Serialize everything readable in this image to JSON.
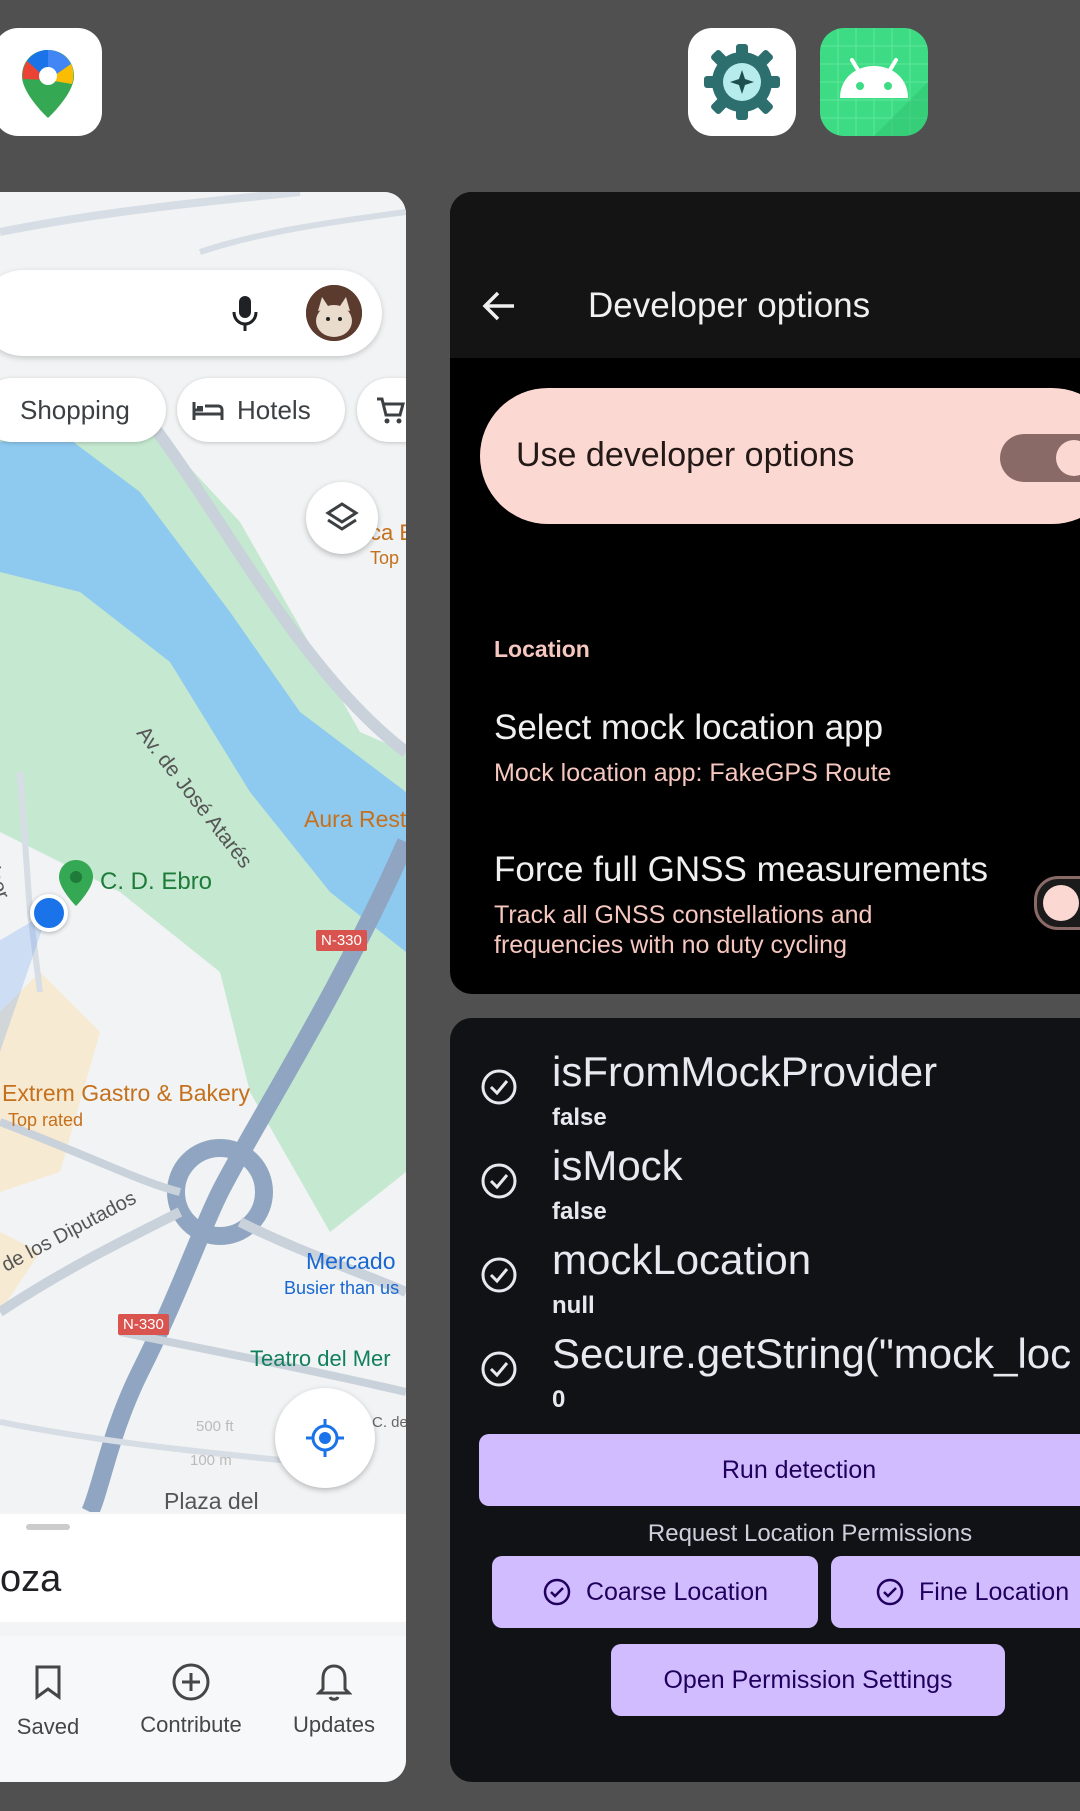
{
  "recents": {
    "app_icons": [
      "google-maps-icon",
      "developer-settings-icon",
      "android-icon"
    ]
  },
  "maps": {
    "chips": [
      "Shopping",
      "Hotels"
    ],
    "map_labels": {
      "road_main": "Av. de José Atarés",
      "road_lower": "de los Diputados",
      "road_left": "Vicor",
      "park": "C. D. Ebro",
      "restaurant": "Aura Rest",
      "bakery": "Extrem Gastro & Bakery",
      "bakery_sub": "Top rated",
      "place_top": "ca E",
      "place_top_sub": "Top",
      "market": "Mercado",
      "market_sub": "Busier than us",
      "theatre": "Teatro del Mer",
      "square": "Plaza del",
      "street_small": "C. de",
      "highway_1": "N-330",
      "highway_2": "N-330",
      "scale_big": "500 ft",
      "scale_small": "100 m"
    },
    "sheet_title": "oza",
    "nav": [
      {
        "label": "Saved",
        "icon": "bookmark-icon"
      },
      {
        "label": "Contribute",
        "icon": "add-circle-icon"
      },
      {
        "label": "Updates",
        "icon": "bell-icon"
      }
    ]
  },
  "dev_options": {
    "title": "Developer options",
    "use_label": "Use developer options",
    "use_enabled": true,
    "section": "Location",
    "mock_title": "Select mock location app",
    "mock_sub": "Mock location app: FakeGPS Route",
    "gnss_title": "Force full GNSS measurements",
    "gnss_sub_1": "Track all GNSS constellations and",
    "gnss_sub_2": "frequencies with no duty cycling",
    "gnss_enabled": false
  },
  "detection": {
    "checks": [
      {
        "name": "isFromMockProvider",
        "value": "false"
      },
      {
        "name": "isMock",
        "value": "false"
      },
      {
        "name": "mockLocation",
        "value": "null"
      },
      {
        "name": "Secure.getString(\"mock_loc",
        "value": "0"
      }
    ],
    "run_button": "Run detection",
    "permissions_heading": "Request Location Permissions",
    "coarse_button": "Coarse Location",
    "fine_button": "Fine Location",
    "settings_button": "Open Permission Settings"
  },
  "colors": {
    "recents_bg": "#505050",
    "dev_accent": "#fcd8d2",
    "detect_accent": "#d0bcff",
    "map_water": "#8ec9f0",
    "map_park": "#c5e8d0"
  }
}
